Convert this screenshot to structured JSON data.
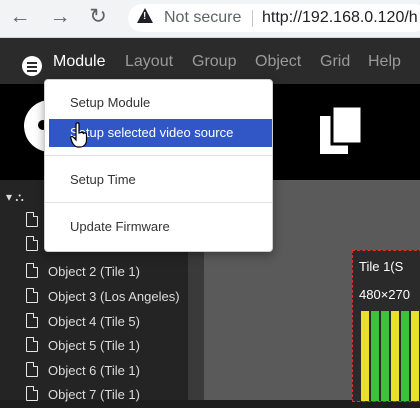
{
  "browser": {
    "back_icon": "arrow-left-icon",
    "forward_icon": "arrow-right-icon",
    "reload_icon": "reload-icon",
    "security_label": "Not secure",
    "url": "http://192.168.0.120/h"
  },
  "menubar": {
    "items": [
      "Module",
      "Layout",
      "Group",
      "Object",
      "Grid",
      "Help"
    ]
  },
  "dropdown": {
    "items": [
      "Setup Module",
      "Setup selected video source",
      "Setup Time",
      "Update Firmware"
    ]
  },
  "tree": {
    "objects": [
      "Object 2 (Tile 1)",
      "Object 3 (Los Angeles)",
      "Object 4 (Tile 5)",
      "Object 5 (Tile 1)",
      "Object 6 (Tile 1)",
      "Object 7 (Tile 1)"
    ]
  },
  "tile": {
    "title": "Tile 1(S",
    "resolution": "480×270"
  },
  "colors": {
    "accent": "#3157c6",
    "tile_border": "#e03030",
    "bar_yellow": "#e8e02a",
    "bar_green": "#3ec23e"
  }
}
